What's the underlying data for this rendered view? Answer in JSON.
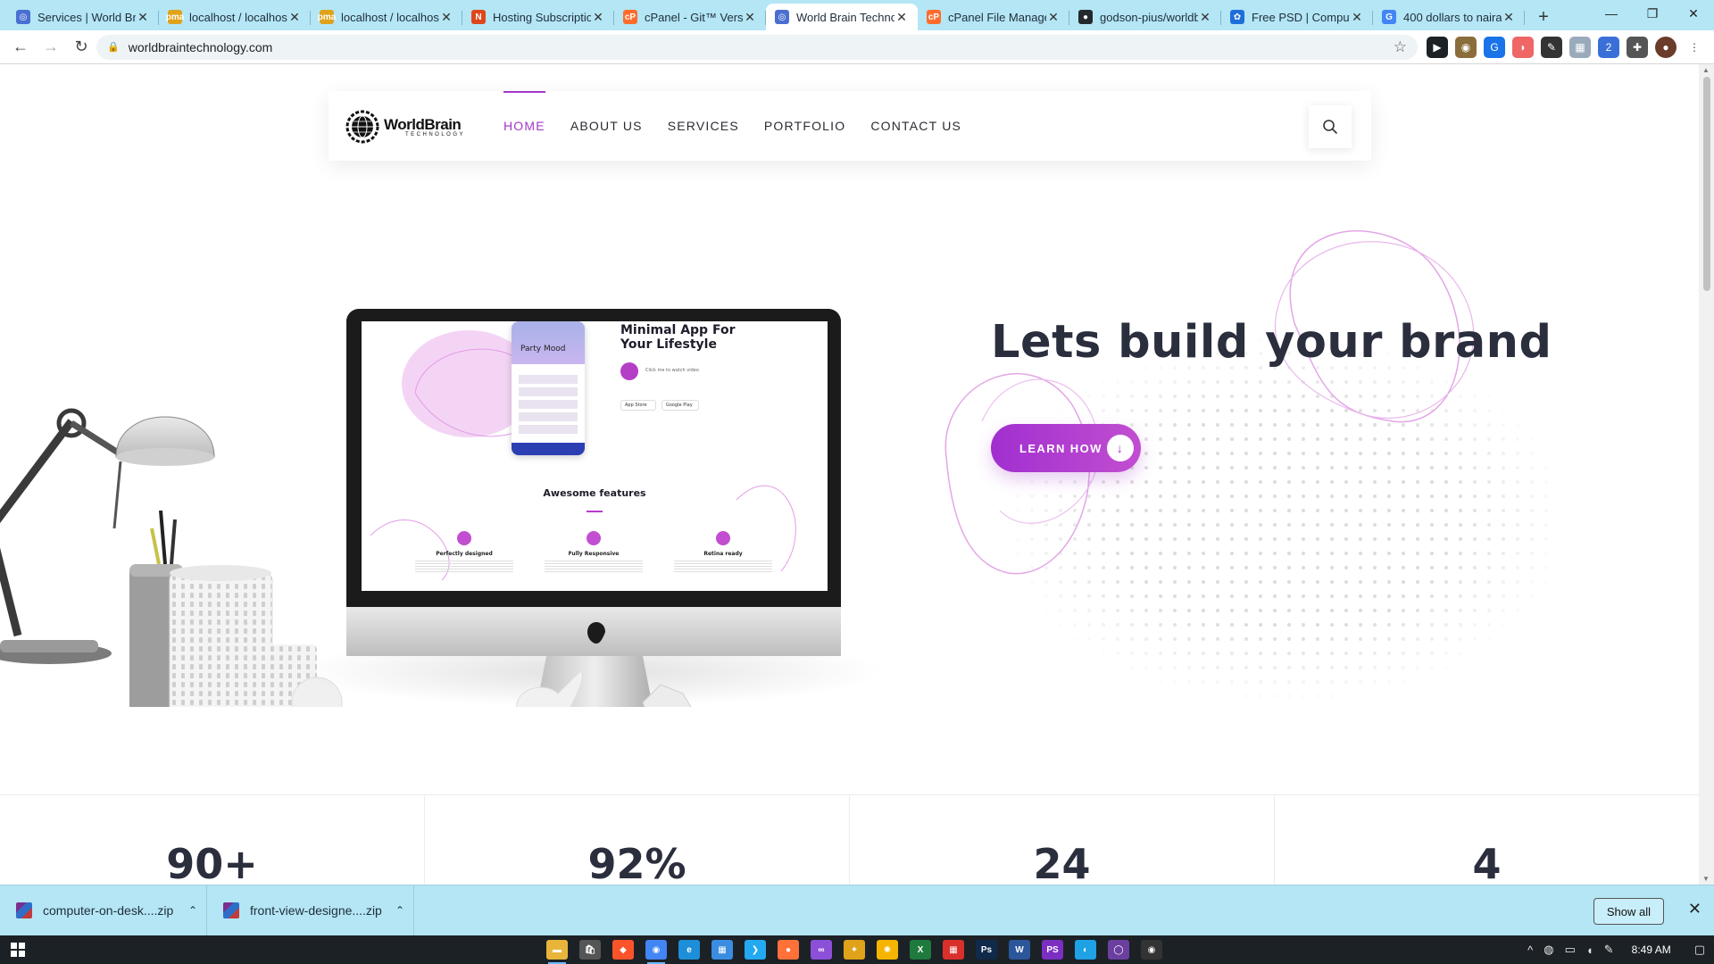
{
  "browser": {
    "tabs": [
      {
        "title": "Services | World Brain",
        "fav_color": "#4a6fd1",
        "fav_glyph": "◎",
        "active": false
      },
      {
        "title": "localhost / localhost",
        "fav_color": "#e0a21a",
        "fav_glyph": "pma",
        "active": false
      },
      {
        "title": "localhost / localhost",
        "fav_color": "#e0a21a",
        "fav_glyph": "pma",
        "active": false
      },
      {
        "title": "Hosting Subscription",
        "fav_color": "#e0461c",
        "fav_glyph": "N",
        "active": false
      },
      {
        "title": "cPanel - Git™ Version",
        "fav_color": "#ff6c2c",
        "fav_glyph": "cP",
        "active": false
      },
      {
        "title": "World Brain Technology",
        "fav_color": "#4a6fd1",
        "fav_glyph": "◎",
        "active": true
      },
      {
        "title": "cPanel File Manager",
        "fav_color": "#ff6c2c",
        "fav_glyph": "cP",
        "active": false
      },
      {
        "title": "godson-pius/worldbrain",
        "fav_color": "#24292e",
        "fav_glyph": "●",
        "active": false
      },
      {
        "title": "Free PSD | Computer",
        "fav_color": "#1e6fd9",
        "fav_glyph": "✿",
        "active": false
      },
      {
        "title": "400 dollars to naira",
        "fav_color": "#4285f4",
        "fav_glyph": "G",
        "active": false
      }
    ],
    "new_tab_glyph": "+",
    "window_controls": {
      "minimize": "—",
      "restore": "❐",
      "close": "✕"
    },
    "url": "worldbraintechnology.com",
    "back_glyph": "←",
    "forward_glyph": "→",
    "reload_glyph": "↻",
    "lock_glyph": "🔒",
    "star_glyph": "☆",
    "extensions": [
      {
        "name": "play-extension",
        "color": "#1c2126",
        "glyph": "▶"
      },
      {
        "name": "eye-extension",
        "color": "#8a6d3b",
        "glyph": "◉"
      },
      {
        "name": "translate-extension",
        "color": "#1a73e8",
        "glyph": "G"
      },
      {
        "name": "cast-extension",
        "color": "#e66",
        "glyph": "◗"
      },
      {
        "name": "tool-extension",
        "color": "#333",
        "glyph": "✎"
      },
      {
        "name": "grid-extension",
        "color": "#9ab",
        "glyph": "▦"
      },
      {
        "name": "badge-extension",
        "color": "#3b6fd8",
        "glyph": "2"
      },
      {
        "name": "puzzle-extension",
        "color": "#555",
        "glyph": "✚"
      },
      {
        "name": "profile-avatar",
        "color": "#6b3b2b",
        "glyph": "●"
      },
      {
        "name": "menu-extension",
        "color": "#fff",
        "glyph": "⋮"
      }
    ]
  },
  "site": {
    "logo": {
      "line1": "WorldBrain",
      "line2": "TECHNOLOGY"
    },
    "menu": [
      {
        "label": "HOME",
        "active": true
      },
      {
        "label": "ABOUT US",
        "active": false
      },
      {
        "label": "SERVICES",
        "active": false
      },
      {
        "label": "PORTFOLIO",
        "active": false
      },
      {
        "label": "CONTACT US",
        "active": false
      }
    ],
    "hero": {
      "title": "Lets build your brand",
      "cta_label": "LEARN HOW",
      "cta_icon": "↓"
    },
    "monitor_screen": {
      "party_title": "Party Mood",
      "app_title_1": "Minimal App For",
      "app_title_2": "Your Lifestyle",
      "watch_video": "Click me to watch video",
      "app_store": "App Store",
      "google_play": "Google Play",
      "features_title": "Awesome features",
      "features": [
        "Perfectly designed",
        "Fully Responsive",
        "Retina ready"
      ]
    },
    "stats": [
      "90+",
      "92%",
      "24",
      "4"
    ]
  },
  "downloads": {
    "items": [
      {
        "name": "computer-on-desk....zip"
      },
      {
        "name": "front-view-designe....zip"
      }
    ],
    "show_all": "Show all",
    "close_glyph": "✕"
  },
  "taskbar": {
    "apps": [
      {
        "name": "file-explorer",
        "color": "#e8b53a",
        "glyph": "▬",
        "active": true
      },
      {
        "name": "store",
        "color": "#555",
        "glyph": "🛍",
        "active": false
      },
      {
        "name": "brave",
        "color": "#fb542b",
        "glyph": "◆",
        "active": false
      },
      {
        "name": "chrome",
        "color": "#4285f4",
        "glyph": "◉",
        "active": true
      },
      {
        "name": "edge",
        "color": "#1d8fd8",
        "glyph": "e",
        "active": false
      },
      {
        "name": "calendar",
        "color": "#3a8de0",
        "glyph": "▦",
        "active": false
      },
      {
        "name": "vscode",
        "color": "#23a9f2",
        "glyph": "❯",
        "active": false
      },
      {
        "name": "firefox",
        "color": "#ff7139",
        "glyph": "●",
        "active": false
      },
      {
        "name": "visual-studio",
        "color": "#8c4fd8",
        "glyph": "∞",
        "active": false
      },
      {
        "name": "app-colorful",
        "color": "#e0a21a",
        "glyph": "✦",
        "active": false
      },
      {
        "name": "app-sun",
        "color": "#f4b400",
        "glyph": "✺",
        "active": false
      },
      {
        "name": "excel",
        "color": "#1f7a3d",
        "glyph": "X",
        "active": false
      },
      {
        "name": "app-grid",
        "color": "#d9302c",
        "glyph": "▦",
        "active": false
      },
      {
        "name": "photoshop",
        "color": "#0f2a4a",
        "glyph": "Ps",
        "active": false
      },
      {
        "name": "word",
        "color": "#2b579a",
        "glyph": "W",
        "active": false
      },
      {
        "name": "phpstorm",
        "color": "#7b2fc2",
        "glyph": "PS",
        "active": false
      },
      {
        "name": "app-blue",
        "color": "#1fa1e6",
        "glyph": "◐",
        "active": false
      },
      {
        "name": "github-desktop",
        "color": "#6b3fa0",
        "glyph": "◯",
        "active": false
      },
      {
        "name": "app-record",
        "color": "#333",
        "glyph": "◉",
        "active": false
      }
    ],
    "time": "8:49 AM"
  }
}
